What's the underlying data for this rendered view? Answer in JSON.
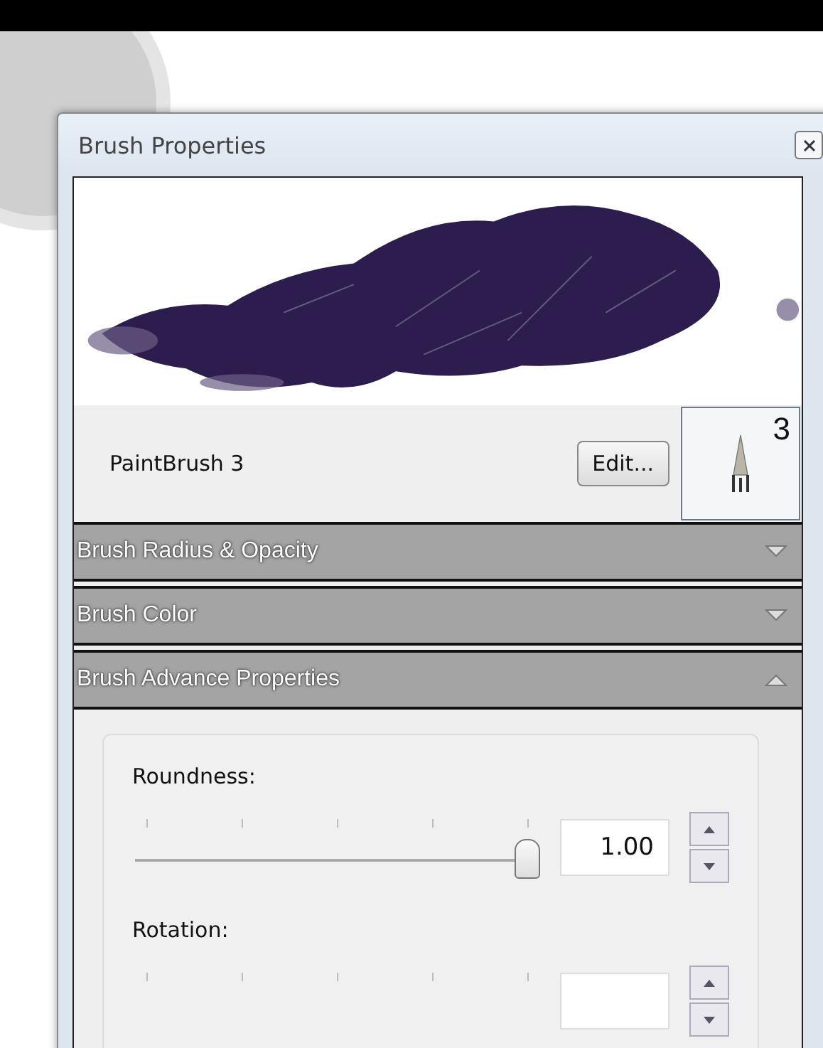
{
  "window": {
    "title": "Brush Properties"
  },
  "brush": {
    "name": "PaintBrush 3",
    "edit_button": "Edit...",
    "size_badge": "3"
  },
  "sections": [
    {
      "title": "Brush Radius & Opacity",
      "expanded": false
    },
    {
      "title": "Brush Color",
      "expanded": false
    },
    {
      "title": "Brush Advance Properties",
      "expanded": true
    }
  ],
  "controls": [
    {
      "label": "Roundness:",
      "level": 0.97,
      "value": "1.00"
    },
    {
      "label": "Rotation:"
    }
  ]
}
